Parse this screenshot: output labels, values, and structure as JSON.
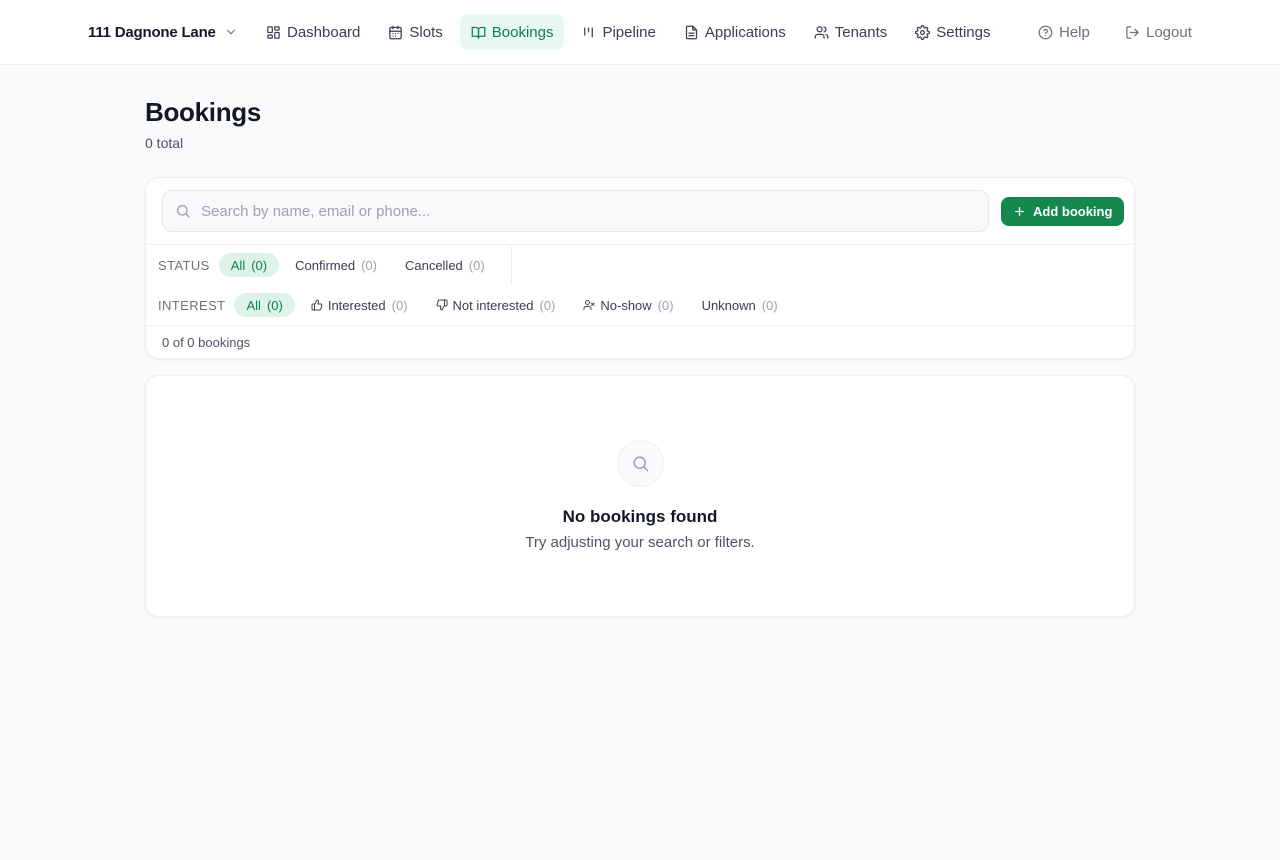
{
  "app": {
    "property_name": "111 Dagnone Lane"
  },
  "nav": {
    "items": [
      {
        "label": "Dashboard",
        "icon": "dashboard-icon"
      },
      {
        "label": "Slots",
        "icon": "calendar-icon"
      },
      {
        "label": "Bookings",
        "icon": "book-open-icon",
        "active": true
      },
      {
        "label": "Pipeline",
        "icon": "kanban-icon"
      },
      {
        "label": "Applications",
        "icon": "document-icon"
      },
      {
        "label": "Tenants",
        "icon": "users-icon"
      },
      {
        "label": "Settings",
        "icon": "gear-icon"
      }
    ],
    "help_label": "Help",
    "logout_label": "Logout"
  },
  "header": {
    "title": "Bookings",
    "subtitle": "0 total"
  },
  "search": {
    "placeholder": "Search by name, email or phone...",
    "value": ""
  },
  "actions": {
    "add_label": "Add booking"
  },
  "filters": {
    "status": {
      "label": "STATUS",
      "options": [
        {
          "label": "All",
          "count": "(0)",
          "active": true
        },
        {
          "label": "Confirmed",
          "count": "(0)"
        },
        {
          "label": "Cancelled",
          "count": "(0)"
        }
      ]
    },
    "interest": {
      "label": "INTEREST",
      "options": [
        {
          "label": "All",
          "count": "(0)",
          "active": true
        },
        {
          "label": "Interested",
          "count": "(0)",
          "icon": "thumbs-up-icon"
        },
        {
          "label": "Not interested",
          "count": "(0)",
          "icon": "thumbs-down-icon"
        },
        {
          "label": "No-show",
          "count": "(0)",
          "icon": "user-x-icon"
        },
        {
          "label": "Unknown",
          "count": "(0)"
        }
      ]
    }
  },
  "results": {
    "summary": "0 of 0 bookings"
  },
  "empty_state": {
    "icon": "search-icon",
    "title": "No bookings found",
    "text": "Try adjusting your search or filters."
  },
  "colors": {
    "accent": "#14874f",
    "accent_soft": "#dcf3e6",
    "background": "#f9fafb"
  }
}
